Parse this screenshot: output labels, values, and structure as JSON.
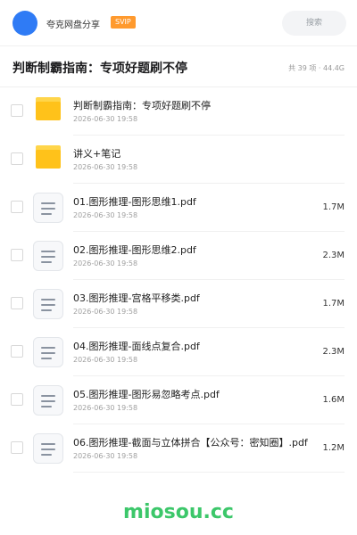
{
  "header": {
    "username": "夸克网盘分享",
    "badge": "SVIP",
    "search_placeholder": "搜索"
  },
  "folder": {
    "title": "判断制霸指南：专项好题刷不停",
    "meta": "共 39 项 · 44.4G"
  },
  "files": [
    {
      "type": "folder",
      "name": "判断制霸指南：专项好题刷不停",
      "date": "2026-06-30 19:58",
      "size": ""
    },
    {
      "type": "folder",
      "name": "讲义+笔记",
      "date": "2026-06-30 19:58",
      "size": ""
    },
    {
      "type": "pdf",
      "name": "01.图形推理-图形思维1.pdf",
      "date": "2026-06-30 19:58",
      "size": "1.7M"
    },
    {
      "type": "pdf",
      "name": "02.图形推理-图形思维2.pdf",
      "date": "2026-06-30 19:58",
      "size": "2.3M"
    },
    {
      "type": "pdf",
      "name": "03.图形推理-宫格平移类.pdf",
      "date": "2026-06-30 19:58",
      "size": "1.7M"
    },
    {
      "type": "pdf",
      "name": "04.图形推理-面线点复合.pdf",
      "date": "2026-06-30 19:58",
      "size": "2.3M"
    },
    {
      "type": "pdf",
      "name": "05.图形推理-图形易忽略考点.pdf",
      "date": "2026-06-30 19:58",
      "size": "1.6M"
    },
    {
      "type": "pdf",
      "name": "06.图形推理-截面与立体拼合【公众号：密知圈】.pdf",
      "date": "2026-06-30 19:58",
      "size": "1.2M"
    }
  ],
  "watermark": "miosou.cc",
  "colors": {
    "accent": "#2f7bf5",
    "svip": "#ff9a2e",
    "folder": "#ffc21a",
    "watermark": "#3cc76a"
  }
}
